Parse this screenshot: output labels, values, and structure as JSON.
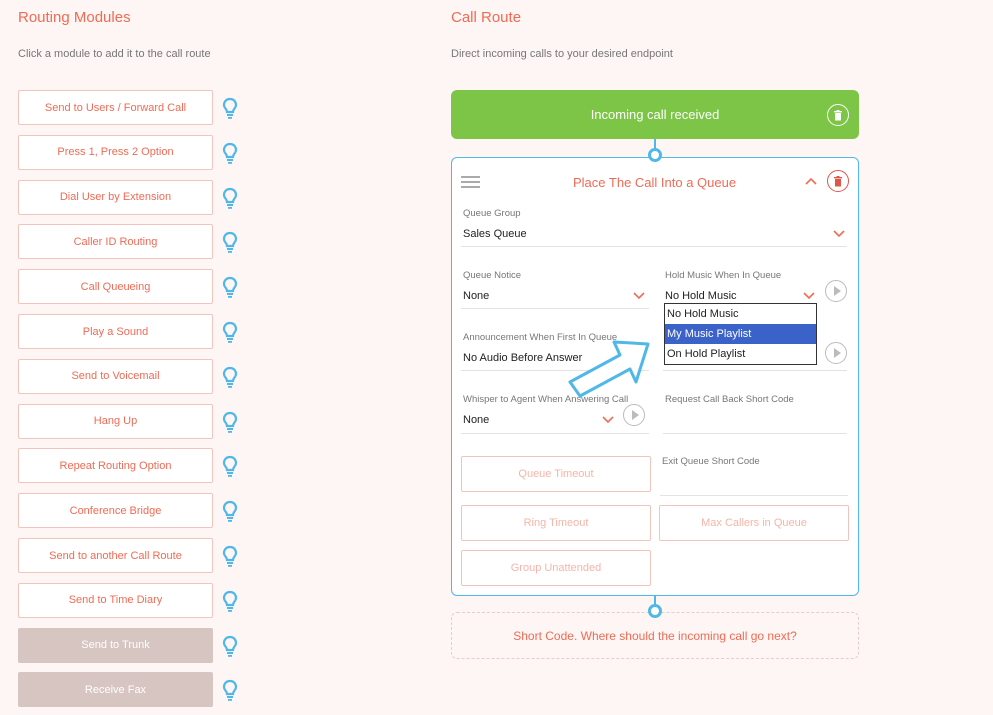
{
  "left_panel": {
    "title": "Routing Modules",
    "subtitle": "Click a module to add it to the call route",
    "modules": [
      {
        "label": "Send to Users / Forward Call",
        "disabled": false
      },
      {
        "label": "Press 1, Press 2 Option",
        "disabled": false
      },
      {
        "label": "Dial User by Extension",
        "disabled": false
      },
      {
        "label": "Caller ID Routing",
        "disabled": false
      },
      {
        "label": "Call Queueing",
        "disabled": false
      },
      {
        "label": "Play a Sound",
        "disabled": false
      },
      {
        "label": "Send to Voicemail",
        "disabled": false
      },
      {
        "label": "Hang Up",
        "disabled": false
      },
      {
        "label": "Repeat Routing Option",
        "disabled": false
      },
      {
        "label": "Conference Bridge",
        "disabled": false
      },
      {
        "label": "Send to another Call Route",
        "disabled": false
      },
      {
        "label": "Send to Time Diary",
        "disabled": false
      },
      {
        "label": "Send to Trunk",
        "disabled": true
      },
      {
        "label": "Receive Fax",
        "disabled": true
      }
    ],
    "hint_icon": "lightbulb-icon"
  },
  "right_panel": {
    "title": "Call Route",
    "subtitle": "Direct incoming calls to your desired endpoint",
    "incoming": "Incoming call received",
    "queue": {
      "title": "Place The Call Into a Queue",
      "queue_group": {
        "label": "Queue Group",
        "value": "Sales Queue"
      },
      "queue_notice": {
        "label": "Queue Notice",
        "value": "None"
      },
      "hold_music": {
        "label": "Hold Music When In Queue",
        "value": "No Hold Music"
      },
      "announcement": {
        "label": "Announcement When First In Queue",
        "value": "No Audio Before Answer"
      },
      "whisper": {
        "label": "Whisper to Agent When Answering Call",
        "value": "None"
      },
      "request_callback": {
        "label": "Request Call Back Short Code"
      },
      "exit_queue": {
        "label": "Exit Queue Short Code"
      },
      "buttons": {
        "queue_timeout": "Queue Timeout",
        "ring_timeout": "Ring Timeout",
        "max_callers": "Max Callers in Queue",
        "group_unattended": "Group Unattended"
      }
    },
    "hold_music_options": [
      {
        "label": "No Hold Music",
        "selected": false
      },
      {
        "label": "My Music Playlist",
        "selected": true
      },
      {
        "label": "On Hold Playlist",
        "selected": false
      }
    ],
    "short_code_prompt": "Short Code. Where should the incoming call go next?"
  },
  "colors": {
    "accent": "#f06b55",
    "green": "#7cc547",
    "blue": "#4fb8e8",
    "selected": "#3a62c8"
  }
}
